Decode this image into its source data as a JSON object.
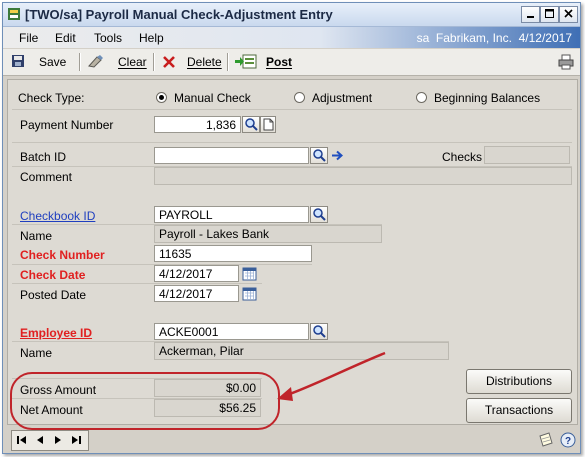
{
  "window": {
    "title": "[TWO/sa] Payroll Manual Check-Adjustment Entry"
  },
  "menu": {
    "items": [
      "File",
      "Edit",
      "Tools",
      "Help"
    ],
    "company_info": "sa  Fabrikam, Inc.  4/12/2017"
  },
  "toolbar": {
    "save": "Save",
    "clear": "Clear",
    "delete": "Delete",
    "post": "Post"
  },
  "form": {
    "check_type_label": "Check Type:",
    "check_type_options": [
      "Manual Check",
      "Adjustment",
      "Beginning Balances"
    ],
    "check_type_selected": "Manual Check",
    "payment_number_label": "Payment Number",
    "payment_number": "1,836",
    "batch_id_label": "Batch ID",
    "batch_id": "",
    "checks_label": "Checks",
    "checks_value": "",
    "comment_label": "Comment",
    "comment": "",
    "checkbook_id_label": "Checkbook ID",
    "checkbook_id": "PAYROLL",
    "checkbook_name_label": "Name",
    "checkbook_name": "Payroll - Lakes Bank",
    "check_number_label": "Check Number",
    "check_number": "11635",
    "check_date_label": "Check Date",
    "check_date": "4/12/2017",
    "posted_date_label": "Posted Date",
    "posted_date": "4/12/2017",
    "employee_id_label": "Employee ID",
    "employee_id": "ACKE0001",
    "employee_name_label": "Name",
    "employee_name": "Ackerman, Pilar",
    "gross_amount_label": "Gross Amount",
    "gross_amount": "$0.00",
    "net_amount_label": "Net Amount",
    "net_amount": "$56.25"
  },
  "buttons": {
    "distributions": "Distributions",
    "transactions": "Transactions"
  },
  "colors": {
    "required_label": "#e02020",
    "link": "#1f3fbf",
    "annotation": "#c0242a"
  }
}
